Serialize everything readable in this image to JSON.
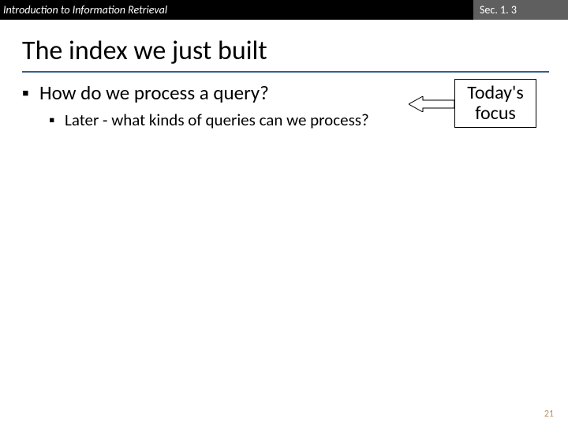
{
  "header": {
    "course_title": "Introduction to Information Retrieval",
    "section_label": "Sec. 1. 3"
  },
  "title": "The index we just built",
  "bullets": {
    "b1": "How do we process a query?",
    "b1_1": "Later - what kinds of queries can we process?"
  },
  "callout": {
    "line1": "Today's",
    "line2": "focus"
  },
  "page_number": "21",
  "colors": {
    "rule": "#385d8a",
    "header_right_bg": "#5f5f5f"
  }
}
